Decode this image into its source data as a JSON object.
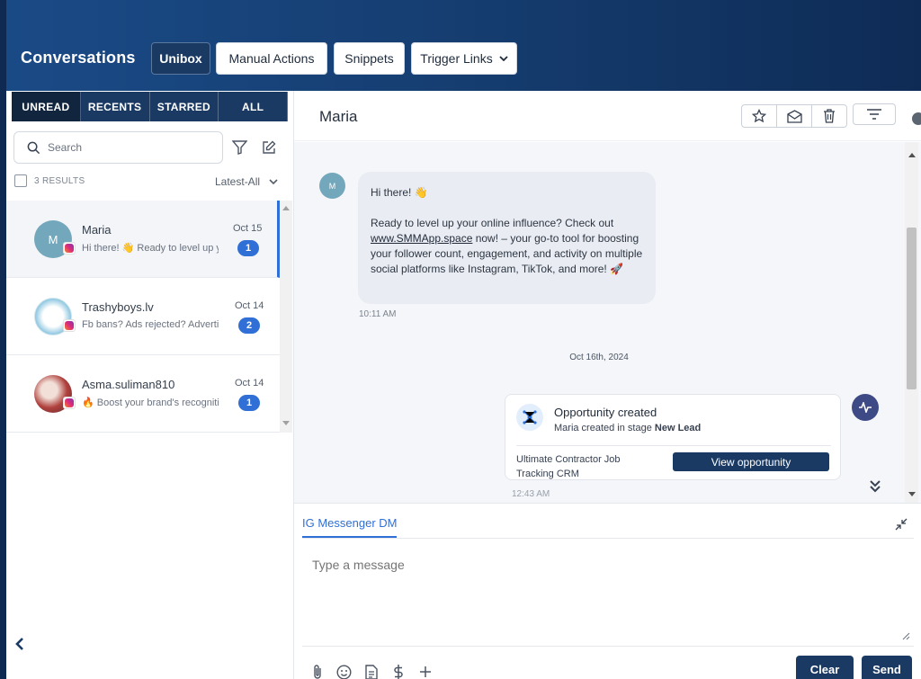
{
  "header": {
    "title": "Conversations",
    "buttons": [
      "Unibox",
      "Manual Actions",
      "Snippets",
      "Trigger Links"
    ]
  },
  "tabs": [
    "UNREAD",
    "RECENTS",
    "STARRED",
    "ALL"
  ],
  "search": {
    "placeholder": "Search"
  },
  "results_label": "3 RESULTS",
  "sort_label": "Latest-All",
  "conversations": [
    {
      "name": "Maria",
      "preview": "Hi there! 👋 Ready to level up your online influence?",
      "date": "Oct 15",
      "unread": "1",
      "avatar_letter": "M"
    },
    {
      "name": "Trashyboys.lv",
      "preview": "Fb bans? Ads rejected? Advertise with us",
      "date": "Oct 14",
      "unread": "2",
      "avatar_letter": ""
    },
    {
      "name": "Asma.suliman810",
      "preview": "🔥 Boost your brand's recognition",
      "date": "Oct 14",
      "unread": "1",
      "avatar_letter": ""
    }
  ],
  "chat": {
    "contact_name": "Maria",
    "avatar_letter": "M",
    "message": {
      "greeting": "Hi there! 👋",
      "body_before_link": "Ready to level up your online influence? Check out ",
      "link": "www.SMMApp.space",
      "body_after_link": " now! – your go-to tool for boosting your follower count, engagement, and activity on multiple social platforms like Instagram, TikTok, and more! 🚀",
      "time": "10:11 AM"
    },
    "date_separator": "Oct 16th, 2024",
    "opportunity": {
      "title": "Opportunity created",
      "subtitle_prefix": "Maria created in stage ",
      "stage": "New Lead",
      "pipeline": "Ultimate Contractor Job Tracking CRM",
      "button": "View opportunity",
      "time": "12:43 AM"
    }
  },
  "composer": {
    "tab": "IG Messenger DM",
    "placeholder": "Type a message",
    "clear": "Clear",
    "send": "Send"
  },
  "colors": {
    "navy": "#1b3a63",
    "accent": "#2f6fd6"
  }
}
